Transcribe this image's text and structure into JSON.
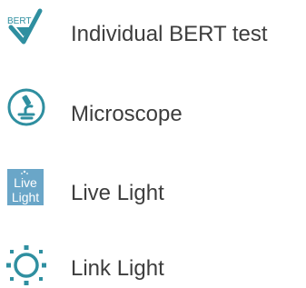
{
  "colors": {
    "accent": "#2f8fa0",
    "text": "#3d3d3d",
    "live_light_bg": "#6aa6c8"
  },
  "menu": {
    "items": [
      {
        "label": "Individual BERT test",
        "icon": "bert-checkmark-icon",
        "icon_text": "BERT"
      },
      {
        "label": "Microscope",
        "icon": "microscope-icon"
      },
      {
        "label": "Live Light",
        "icon": "live-light-icon",
        "icon_text_top": "Live",
        "icon_text_bottom": "Light"
      },
      {
        "label": "Link Light",
        "icon": "link-light-icon"
      }
    ]
  }
}
